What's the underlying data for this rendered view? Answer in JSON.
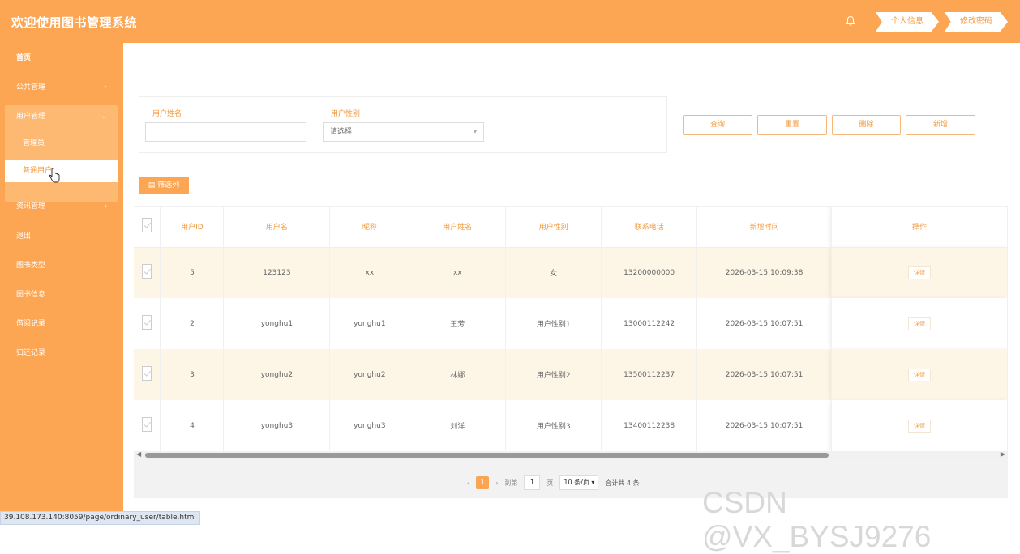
{
  "header": {
    "title": "欢迎使用图书管理系统",
    "profile_label": "个人信息",
    "password_label": "修改密码"
  },
  "sidebar": {
    "home": "首页",
    "public": "公共管理",
    "user": "用户管理",
    "user_sub": [
      "管理员",
      "普通用户"
    ],
    "news": "资讯管理",
    "logout": "退出",
    "book_type": "图书类型",
    "book_info": "图书信息",
    "borrow": "借阅记录",
    "return": "归还记录"
  },
  "search": {
    "name_label": "用户姓名",
    "name_value": "",
    "gender_label": "用户性别",
    "gender_placeholder": "请选择"
  },
  "buttons": {
    "query": "查询",
    "reset": "重置",
    "delete": "删除",
    "add": "新增",
    "filter": "筛选列"
  },
  "table": {
    "headers": [
      "用户ID",
      "用户名",
      "昵称",
      "用户姓名",
      "用户性别",
      "联系电话",
      "新增时间",
      "操作"
    ],
    "rows": [
      [
        "5",
        "123123",
        "xx",
        "xx",
        "女",
        "13200000000",
        "2026-03-15 10:09:38"
      ],
      [
        "2",
        "yonghu1",
        "yonghu1",
        "王芳",
        "用户性别1",
        "13000112242",
        "2026-03-15 10:07:51"
      ],
      [
        "3",
        "yonghu2",
        "yonghu2",
        "林娜",
        "用户性别2",
        "13500112237",
        "2026-03-15 10:07:51"
      ],
      [
        "4",
        "yonghu3",
        "yonghu3",
        "刘洋",
        "用户性别3",
        "13400112238",
        "2026-03-15 10:07:51"
      ]
    ],
    "detail_label": "详情"
  },
  "pager": {
    "current": "1",
    "goto_label": "到第",
    "goto_value": "1",
    "page_unit": "页",
    "page_size": "10 条/页",
    "total": "合计共 4 条"
  },
  "status_url": "39.108.173.140:8059/page/ordinary_user/table.html",
  "watermark": "CSDN @VX_BYSJ9276",
  "colors": {
    "accent": "#fca552",
    "row_highlight": "#fdf5e6"
  }
}
